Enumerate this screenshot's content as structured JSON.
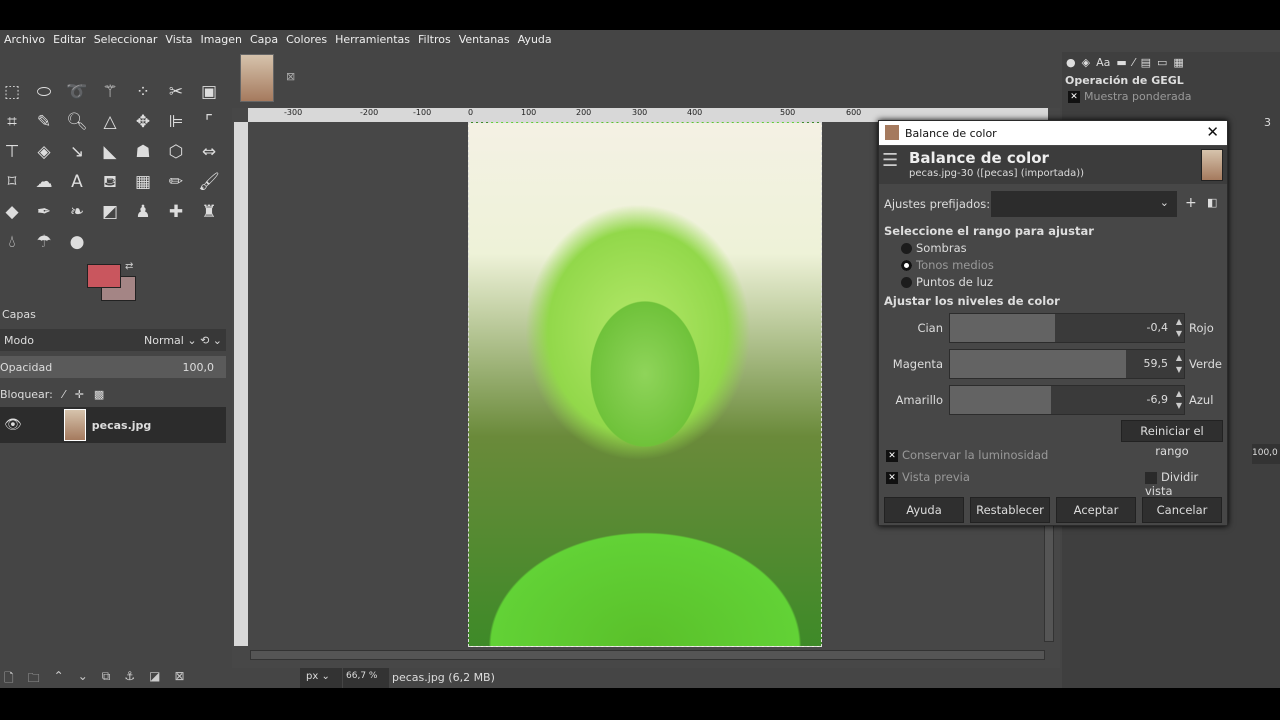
{
  "menu": [
    "Archivo",
    "Editar",
    "Seleccionar",
    "Vista",
    "Imagen",
    "Capa",
    "Colores",
    "Herramientas",
    "Filtros",
    "Ventanas",
    "Ayuda"
  ],
  "layers": {
    "tab": "Capas",
    "mode_label": "Modo",
    "mode_value": "Normal",
    "opacity_label": "Opacidad",
    "opacity_value": "100,0",
    "lock_label": "Bloquear:",
    "layer_name": "pecas.jpg"
  },
  "ruler": [
    "-300",
    "-200",
    "-100",
    "0",
    "100",
    "200",
    "300",
    "400",
    "500",
    "600"
  ],
  "status": {
    "unit": "px",
    "zoom": "66,7 %",
    "file": "pecas.jpg (6,2 MB)"
  },
  "dock": {
    "gegl_title": "Operación de GEGL",
    "gegl_option": "Muestra ponderada",
    "spin_value": "3",
    "opacity_value": "100,0"
  },
  "dialog": {
    "window_title": "Balance de color",
    "header": "Balance de color",
    "subtitle": "pecas.jpg-30 ([pecas] (importada))",
    "presets_label": "Ajustes prefijados:",
    "range_title": "Seleccione el rango para ajustar",
    "ranges": [
      "Sombras",
      "Tonos medios",
      "Puntos de luz"
    ],
    "selected_range": "Tonos medios",
    "levels_title": "Ajustar los niveles de color",
    "sliders": [
      {
        "left": "Cian",
        "right": "Rojo",
        "value": "-0,4",
        "fraction": 0.45
      },
      {
        "left": "Magenta",
        "right": "Verde",
        "value": "59,5",
        "fraction": 0.75
      },
      {
        "left": "Amarillo",
        "right": "Azul",
        "value": "-6,9",
        "fraction": 0.43
      }
    ],
    "reset_range": "Reiniciar el rango",
    "preserve": "Conservar la luminosidad",
    "preview": "Vista previa",
    "split": "Dividir vista",
    "buttons": [
      "Ayuda",
      "Restablecer",
      "Aceptar",
      "Cancelar"
    ]
  }
}
